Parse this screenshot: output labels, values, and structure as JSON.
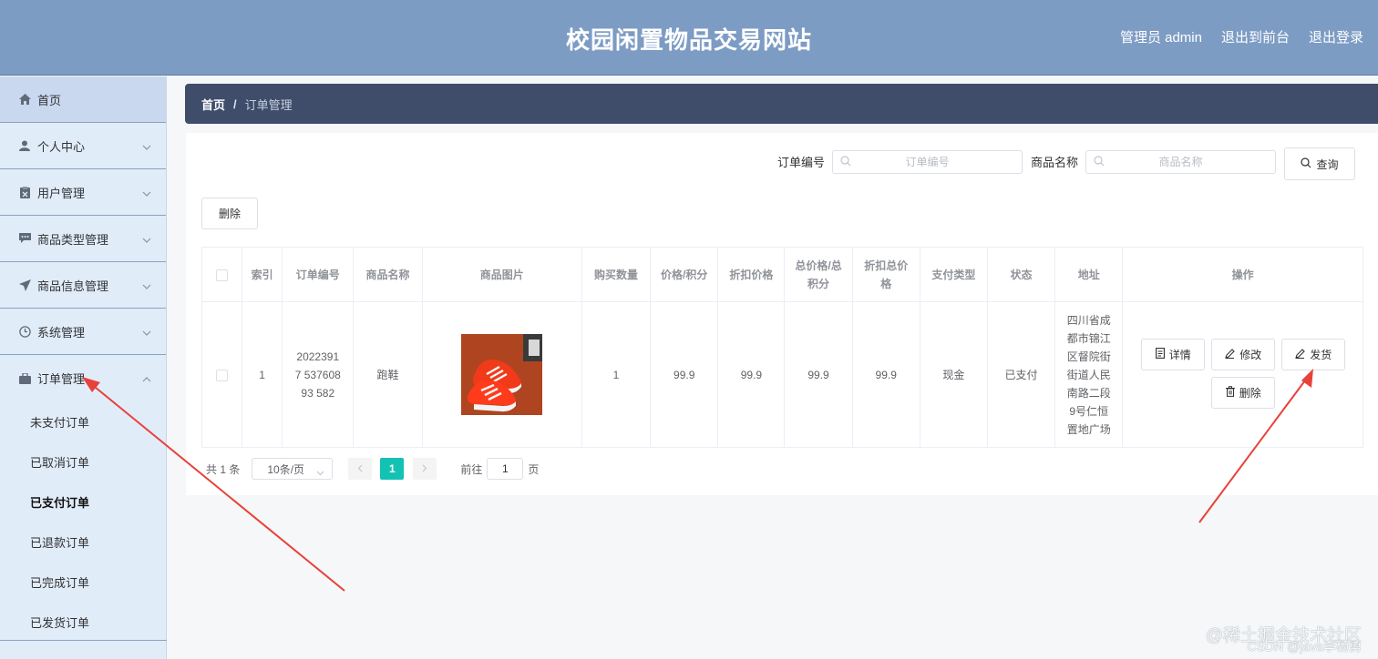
{
  "header": {
    "title": "校园闲置物品交易网站",
    "admin_label": "管理员 admin",
    "to_front": "退出到前台",
    "logout": "退出登录"
  },
  "sidebar": {
    "items": [
      {
        "label": "首页",
        "icon": "home-icon"
      },
      {
        "label": "个人中心",
        "icon": "user-icon"
      },
      {
        "label": "用户管理",
        "icon": "clipboard-icon"
      },
      {
        "label": "商品类型管理",
        "icon": "chat-icon"
      },
      {
        "label": "商品信息管理",
        "icon": "send-icon"
      },
      {
        "label": "系统管理",
        "icon": "clock-icon"
      },
      {
        "label": "订单管理",
        "icon": "bag-icon"
      }
    ],
    "subitems": [
      "未支付订单",
      "已取消订单",
      "已支付订单",
      "已退款订单",
      "已完成订单",
      "已发货订单"
    ]
  },
  "breadcrumb": {
    "home": "首页",
    "separator": "/",
    "current": "订单管理"
  },
  "search": {
    "order_no_label": "订单编号",
    "order_no_placeholder": "订单编号",
    "product_label": "商品名称",
    "product_placeholder": "商品名称",
    "query_button": "查询"
  },
  "toolbar": {
    "delete_button": "删除"
  },
  "table": {
    "headers": [
      "索引",
      "订单编号",
      "商品名称",
      "商品图片",
      "购买数量",
      "价格/积分",
      "折扣价格",
      "总价格/总积分",
      "折扣总价格",
      "支付类型",
      "状态",
      "地址",
      "操作"
    ],
    "rows": [
      {
        "index": "1",
        "order_no": "20223917 53760893 582",
        "product": "跑鞋",
        "quantity": "1",
        "price": "99.9",
        "discount_price": "99.9",
        "total": "99.9",
        "discount_total": "99.9",
        "pay_type": "现金",
        "status": "已支付",
        "address": "四川省成都市锦江区督院街街道人民南路二段9号仁恒置地广场",
        "actions": {
          "detail": "详情",
          "edit": "修改",
          "ship": "发货",
          "delete": "删除"
        }
      }
    ]
  },
  "pagination": {
    "total_text": "共 1 条",
    "page_size": "10条/页",
    "current_page": "1",
    "goto_label": "前往",
    "goto_value": "1",
    "page_suffix": "页"
  },
  "watermark": {
    "line1": "@稀土掘金技术社区",
    "line2": "CSDN @java李杨勇"
  },
  "colors": {
    "header_bg": "#7d9cc4",
    "sidebar_bg": "#e1ecf9",
    "breadcrumb_bg": "#3f4d6b",
    "page_active": "#14c2b4",
    "arrow": "#e8413a"
  }
}
